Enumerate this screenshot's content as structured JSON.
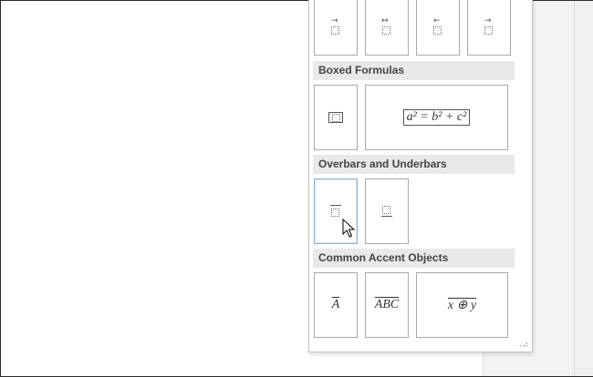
{
  "gallery": {
    "sections": [
      {
        "title": "Boxed Formulas"
      },
      {
        "title": "Overbars and Underbars"
      },
      {
        "title": "Common Accent Objects"
      }
    ],
    "boxed_formula_text": "a² = b² + c²",
    "accents": {
      "a_label": "A",
      "abc_label": "ABC",
      "xy_label": "x ⊕ y"
    }
  },
  "colors": {
    "section_header_bg": "#e9e9e9",
    "tile_border": "#a8a8a8",
    "hover_border": "#8fb0d6"
  },
  "icons": [
    "placeholder-box-icon",
    "arrow-right-icon",
    "arrow-left-right-icon",
    "arrow-left-icon",
    "mouse-pointer-icon",
    "resize-grip-icon"
  ]
}
